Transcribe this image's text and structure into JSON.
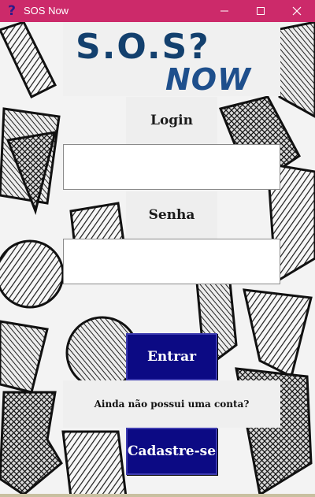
{
  "window": {
    "title": "SOS Now",
    "app_icon": "question-mark-icon",
    "titlebar_color": "#cc2a6a"
  },
  "logo": {
    "line1": "S.O.S?",
    "line2": "NOW",
    "color": "#13406e"
  },
  "form": {
    "login_label": "Login",
    "login_value": "",
    "password_label": "Senha",
    "password_value": "",
    "submit_label": "Entrar",
    "no_account_text": "Ainda não possui uma conta?",
    "register_label": "Cadastre-se",
    "button_color": "#0c0a84"
  }
}
